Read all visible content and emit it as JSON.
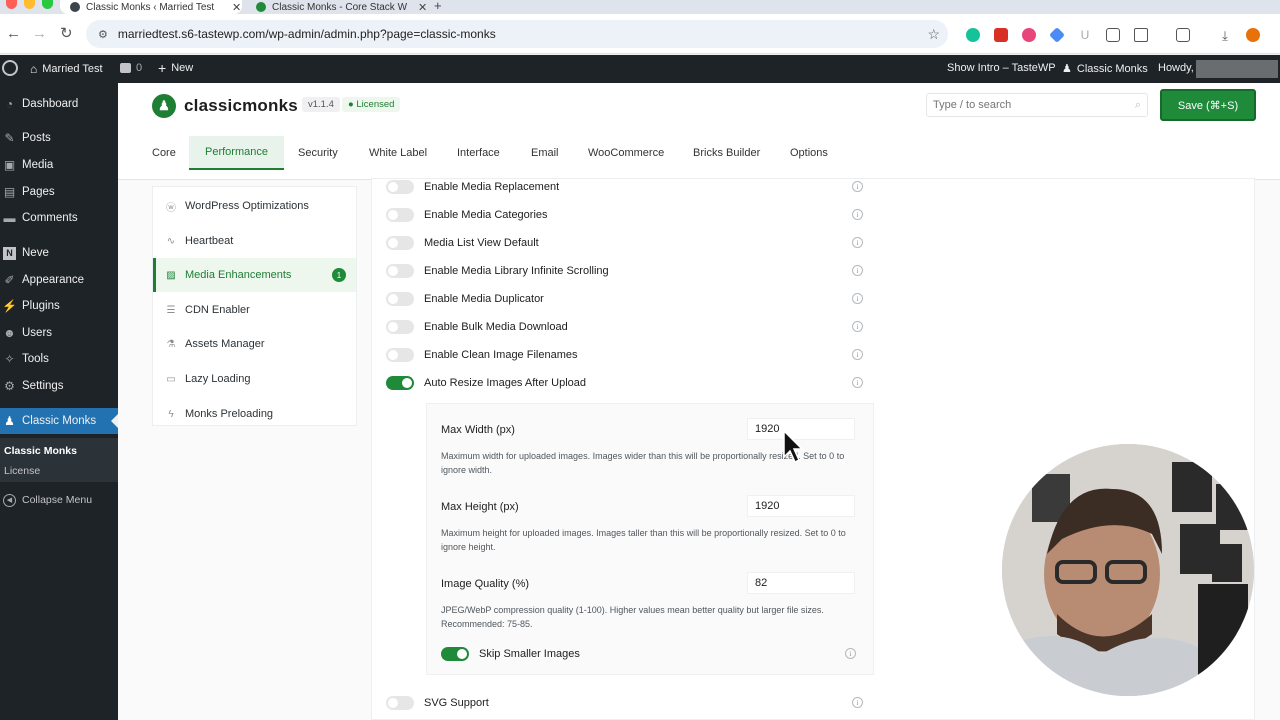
{
  "browser": {
    "tabs": [
      {
        "title": "Classic Monks ‹ Married Test",
        "active": true
      },
      {
        "title": "Classic Monks - Core Stack W",
        "active": false
      }
    ],
    "new_tab": "+",
    "url": "marriedtest.s6-tastewp.com/wp-admin/admin.php?page=classic-monks"
  },
  "adminbar": {
    "site_name": "Married Test",
    "comments_count": "0",
    "new_label": "New",
    "show_intro": "Show Intro – TasteWP",
    "classic_monks": "Classic Monks",
    "howdy": "Howdy,"
  },
  "adminmenu": {
    "items": [
      {
        "label": "Dashboard",
        "icon": "dashboard-icon"
      },
      {
        "label": "Posts",
        "icon": "pin-icon"
      },
      {
        "label": "Media",
        "icon": "media-icon"
      },
      {
        "label": "Pages",
        "icon": "pages-icon"
      },
      {
        "label": "Comments",
        "icon": "comments-icon"
      },
      {
        "label": "Neve",
        "icon": "neve-icon"
      },
      {
        "label": "Appearance",
        "icon": "brush-icon"
      },
      {
        "label": "Plugins",
        "icon": "plug-icon"
      },
      {
        "label": "Users",
        "icon": "user-icon"
      },
      {
        "label": "Tools",
        "icon": "wrench-icon"
      },
      {
        "label": "Settings",
        "icon": "settings-icon"
      },
      {
        "label": "Classic Monks",
        "icon": "monk-icon"
      }
    ],
    "submenu": [
      "Classic Monks",
      "License"
    ],
    "collapse": "Collapse Menu"
  },
  "plugin": {
    "name": "classicmonks",
    "version": "v1.1.4",
    "licensed": "Licensed",
    "search_placeholder": "Type / to search",
    "save_label": "Save (⌘+S)",
    "tabs": [
      "Core",
      "Performance",
      "Security",
      "White Label",
      "Interface",
      "Email",
      "WooCommerce",
      "Bricks Builder",
      "Options"
    ],
    "active_tab": "Performance"
  },
  "subnav": {
    "items": [
      {
        "label": "WordPress Optimizations",
        "icon": "wordpress-icon"
      },
      {
        "label": "Heartbeat",
        "icon": "heartbeat-icon"
      },
      {
        "label": "Media Enhancements",
        "icon": "image-icon",
        "badge": "1"
      },
      {
        "label": "CDN Enabler",
        "icon": "database-icon"
      },
      {
        "label": "Assets Manager",
        "icon": "flask-icon"
      },
      {
        "label": "Lazy Loading",
        "icon": "window-icon"
      },
      {
        "label": "Monks Preloading",
        "icon": "bolt-icon"
      }
    ]
  },
  "settings": [
    {
      "label": "Enable Media Replacement",
      "on": false
    },
    {
      "label": "Enable Media Categories",
      "on": false
    },
    {
      "label": "Media List View Default",
      "on": false
    },
    {
      "label": "Enable Media Library Infinite Scrolling",
      "on": false
    },
    {
      "label": "Enable Media Duplicator",
      "on": false
    },
    {
      "label": "Enable Bulk Media Download",
      "on": false
    },
    {
      "label": "Enable Clean Image Filenames",
      "on": false
    },
    {
      "label": "Auto Resize Images After Upload",
      "on": true
    }
  ],
  "resize": {
    "max_width": {
      "label": "Max Width (px)",
      "value": "1920",
      "help": "Maximum width for uploaded images. Images wider than this will be proportionally resized. Set to 0 to ignore width."
    },
    "max_height": {
      "label": "Max Height (px)",
      "value": "1920",
      "help": "Maximum height for uploaded images. Images taller than this will be proportionally resized. Set to 0 to ignore height."
    },
    "quality": {
      "label": "Image Quality (%)",
      "value": "82",
      "help": "JPEG/WebP compression quality (1-100). Higher values mean better quality but larger file sizes. Recommended: 75-85."
    },
    "skip_smaller": {
      "label": "Skip Smaller Images",
      "on": true
    }
  },
  "svg_support": {
    "label": "SVG Support",
    "on": false
  },
  "colors": {
    "accent": "#1e8a3a",
    "admin_bar": "#1d2327",
    "admin_current": "#2271b1"
  }
}
